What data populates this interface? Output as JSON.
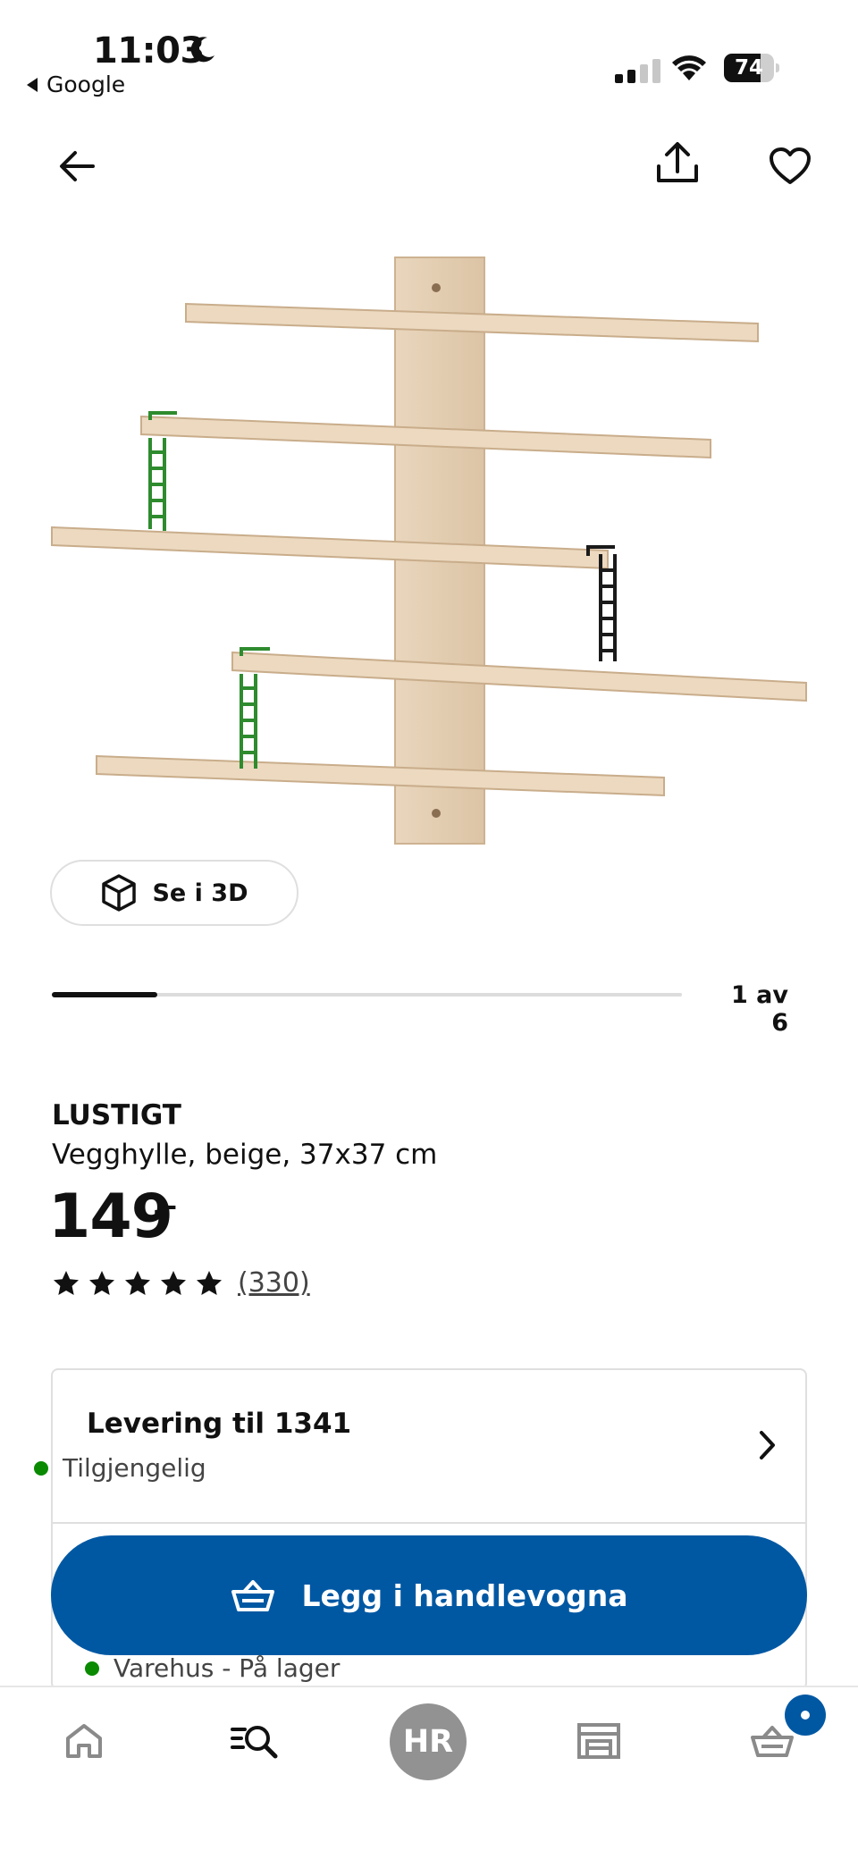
{
  "status_bar": {
    "time": "11:03",
    "back_app": "Google",
    "battery": "74",
    "battery_level": 0.74
  },
  "icons": {
    "back": "arrow-left-icon",
    "share": "share-icon",
    "favorite": "heart-icon",
    "view_3d": "cube-icon",
    "delivery_chevron": "chevron-right-icon",
    "cart": "basket-icon",
    "tabs": [
      "home-icon",
      "search-icon",
      "avatar",
      "store-icon",
      "basket-icon"
    ]
  },
  "gallery": {
    "view_3d_label": "Se i 3D",
    "pager_text": "1 av 6",
    "current": 1,
    "total": 6
  },
  "product": {
    "name": "LUSTIGT",
    "description": "Vegghylle, beige, 37x37 cm",
    "price": "149",
    "price_suffix": ",–",
    "rating": 5,
    "review_count": "(330)"
  },
  "availability": {
    "delivery_title": "Levering til 1341",
    "delivery_status": "Tilgjengelig",
    "store_status": "Varehus - På lager"
  },
  "cart_button": {
    "label": "Legg i handlevogna"
  },
  "bottom_nav": {
    "avatar_initials": "HR"
  },
  "colors": {
    "brand_blue": "#0058a3",
    "available_green": "#0a8a00",
    "wood": "#ecd9c0",
    "ladder_green": "#2e8b2e"
  }
}
